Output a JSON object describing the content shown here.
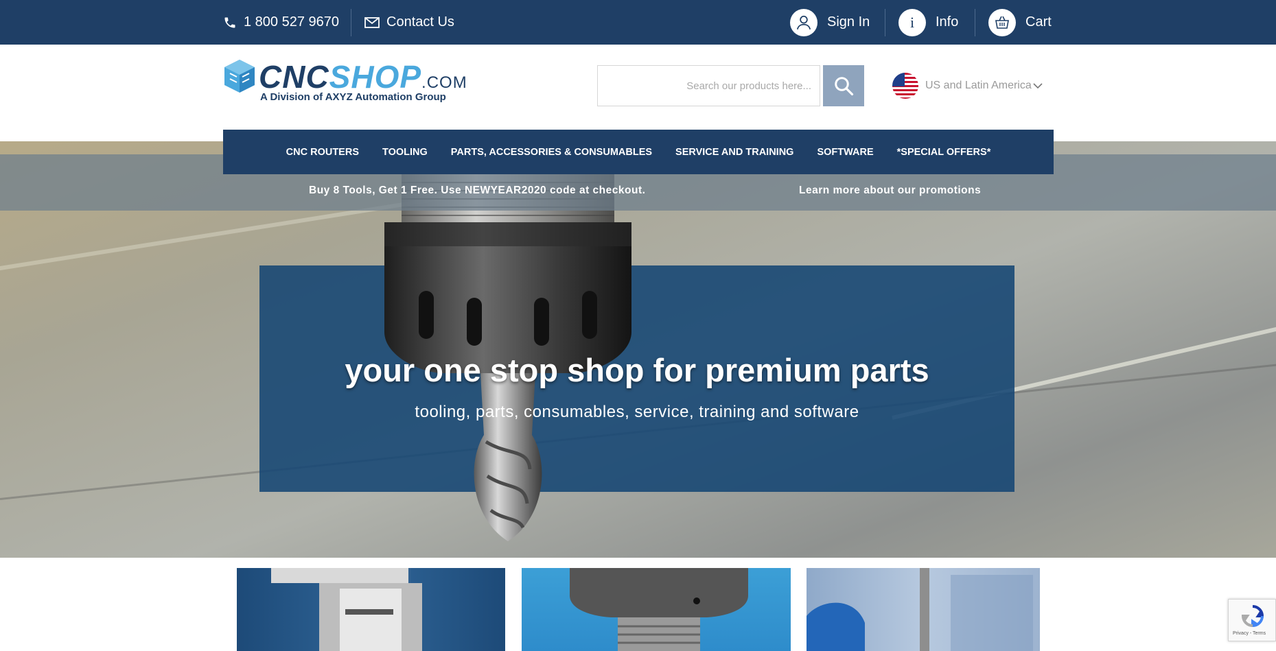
{
  "topbar": {
    "phone": "1 800 527 9670",
    "contact": "Contact Us",
    "sign_in": "Sign In",
    "info": "Info",
    "cart": "Cart"
  },
  "header": {
    "logo_cnc": "CNC",
    "logo_shop": "SHOP",
    "logo_com": ".COM",
    "logo_tagline": "A Division of AXYZ Automation Group",
    "search_placeholder": "Search our products here...",
    "region": "US and Latin America"
  },
  "nav": {
    "items": [
      "CNC ROUTERS",
      "TOOLING",
      "PARTS, ACCESSORIES & CONSUMABLES",
      "SERVICE AND TRAINING",
      "SOFTWARE",
      "*SPECIAL OFFERS*"
    ]
  },
  "promo": {
    "message": "Buy 8 Tools, Get 1 Free. Use NEWYEAR2020 code at checkout.",
    "link": "Learn more about our promotions"
  },
  "hero": {
    "title": "your one stop shop for premium parts",
    "subtitle": "tooling, parts, consumables, service, training and software"
  },
  "colors": {
    "primary": "#1f3f66",
    "accent": "#4aa8dd",
    "search_button": "#8fa4bd"
  },
  "recaptcha": {
    "text": "Privacy - Terms"
  }
}
